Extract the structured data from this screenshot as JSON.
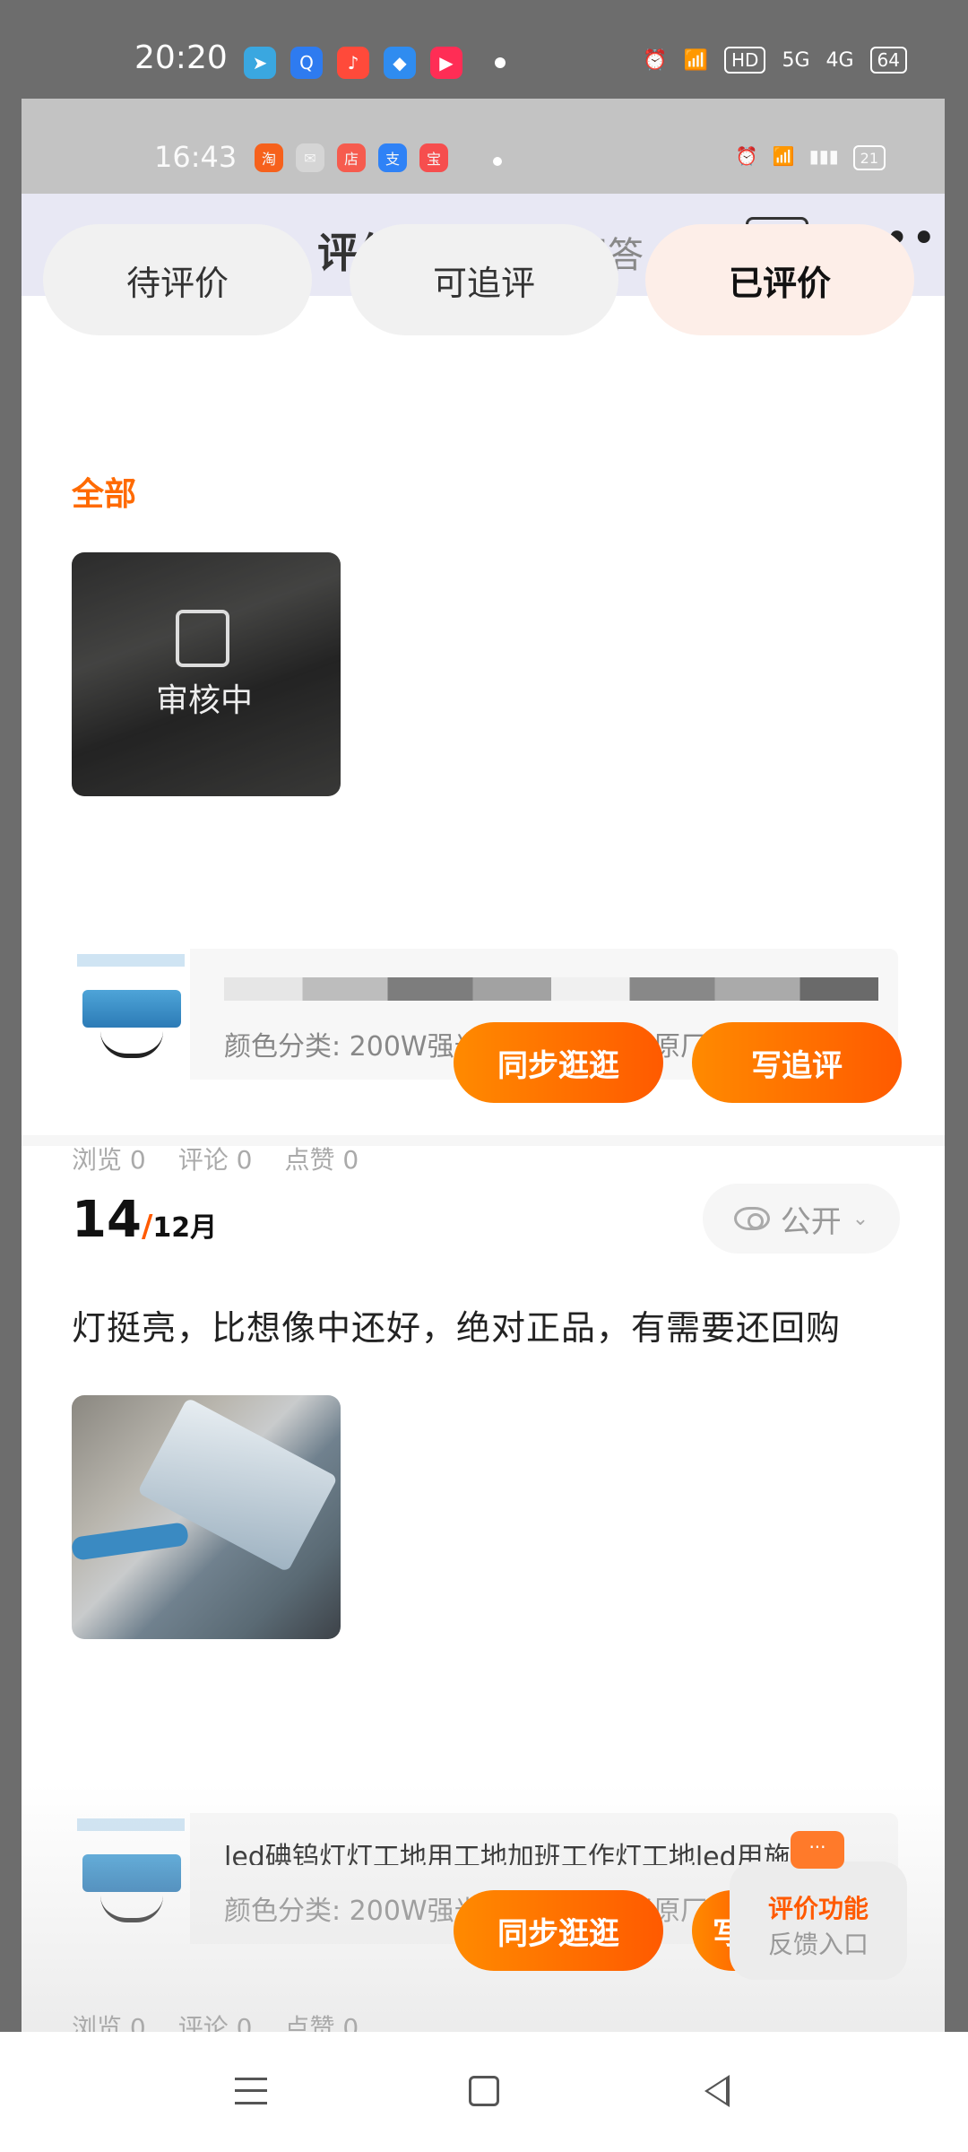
{
  "outer_status": {
    "time": "20:20",
    "apps": [
      {
        "icon": "telegram-icon",
        "color": "#3aa7e0",
        "glyph": "➤"
      },
      {
        "icon": "search-app-icon",
        "color": "#2e7bf0",
        "glyph": "Q"
      },
      {
        "icon": "music-app-icon",
        "color": "#ff4a3a",
        "glyph": "♪"
      },
      {
        "icon": "blue-app-icon",
        "color": "#2f8cf0",
        "glyph": "◆"
      },
      {
        "icon": "video-app-icon",
        "color": "#ff2d55",
        "glyph": "▶"
      }
    ],
    "hd": "HD",
    "net1": "5G",
    "net2": "4G",
    "battery": "64"
  },
  "inner_status": {
    "time": "16:43",
    "apps": [
      {
        "icon": "taobao-app-icon",
        "color": "#ff5000",
        "glyph": "淘"
      },
      {
        "icon": "wechat-icon",
        "color": "#e6e6e6",
        "glyph": "✉"
      },
      {
        "icon": "shop-app-icon",
        "color": "#ff4a3a",
        "glyph": "店"
      },
      {
        "icon": "alipay-icon",
        "color": "#1677ff",
        "glyph": "支"
      },
      {
        "icon": "red-app-icon",
        "color": "#ff3a3a",
        "glyph": "宝"
      }
    ],
    "battery": "21"
  },
  "nav": {
    "back": "<",
    "title": "评价",
    "qa": "问答",
    "rules_l1": "评价",
    "rules_l2": "规则",
    "more": "•••"
  },
  "tabs": [
    {
      "label": "待评价",
      "active": false
    },
    {
      "label": "可追评",
      "active": false
    },
    {
      "label": "已评价",
      "active": true
    }
  ],
  "filter_all": "全部",
  "review1": {
    "status": "审核中",
    "product": {
      "name": "",
      "variant": "颜色分类: 200W强光(四年质保)5米原厂铜线"
    },
    "stats": {
      "views": "浏览 0",
      "comments": "评论 0",
      "likes": "点赞 0"
    },
    "sync_button": "同步逛逛",
    "follow_button": "写追评"
  },
  "review2": {
    "day": "14",
    "slash": "/",
    "month": "12月",
    "visibility": "公开",
    "text": "灯挺亮，比想像中还好，绝对正品，有需要还回购",
    "product": {
      "name": "led碘钨灯灯工地用工地加班工作灯工地led用施工...",
      "variant": "颜色分类: 200W强光(四年质保)5米原厂铜线"
    },
    "stats": {
      "views": "浏览 0",
      "comments": "评论 0",
      "likes": "点赞 0"
    },
    "sync_button": "同步逛逛",
    "follow_button": "写"
  },
  "feedback": {
    "line1": "评价功能",
    "line2": "反馈入口",
    "bubble": "···"
  },
  "colors": {
    "accent": "#ff6a00",
    "button_start": "#ff8a00",
    "button_end": "#ff5a00",
    "active_tab_bg": "#fdeee8"
  }
}
